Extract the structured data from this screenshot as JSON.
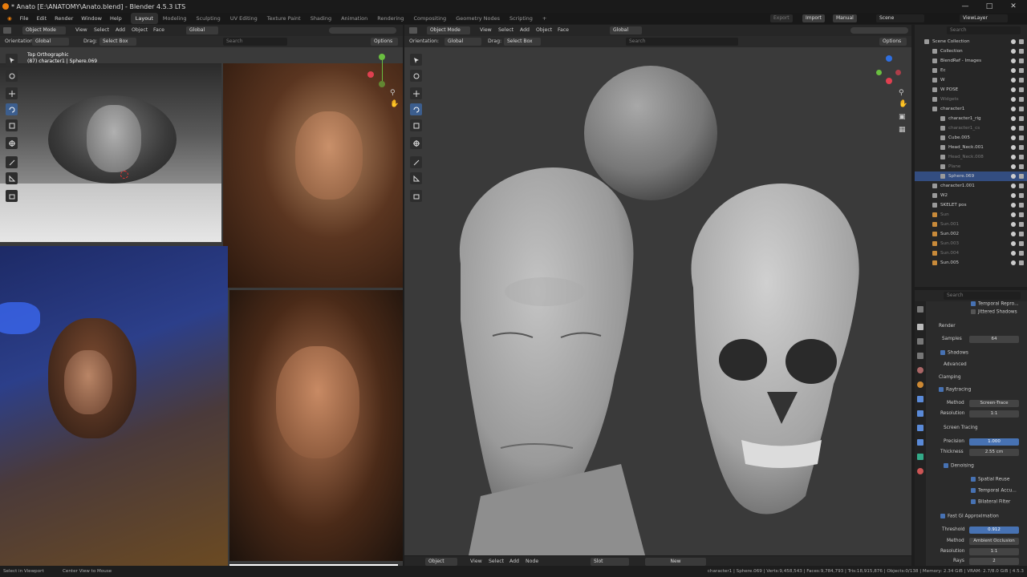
{
  "window": {
    "title": "* Anato [E:\\ANATOMY\\Anato.blend] - Blender 4.5.3 LTS"
  },
  "menubar": {
    "menus": [
      "File",
      "Edit",
      "Render",
      "Window",
      "Help"
    ],
    "workspaces": [
      "Layout",
      "Modeling",
      "Sculpting",
      "UV Editing",
      "Texture Paint",
      "Shading",
      "Animation",
      "Rendering",
      "Compositing",
      "Geometry Nodes",
      "Scripting"
    ],
    "add_tab": "+",
    "export": "Export",
    "import": "Import",
    "manual": "Manual",
    "scene": "Scene",
    "view_layer": "ViewLayer"
  },
  "left_editor": {
    "mode": "Object Mode",
    "menus": [
      "View",
      "Select",
      "Add",
      "Object",
      "Face"
    ],
    "orientation_label": "Orientation:",
    "orientation_value": "Global",
    "transform": "Global",
    "drag_label": "Drag:",
    "drag_value": "Select Box",
    "search_placeholder": "Search",
    "options": "Options",
    "overlay_line1": "Top Orthographic",
    "overlay_line2": "(87) character1 | Sphere.069"
  },
  "right_editor": {
    "mode": "Object Mode",
    "menus": [
      "View",
      "Select",
      "Add",
      "Object",
      "Face"
    ],
    "orientation_label": "Orientation:",
    "orientation_value": "Global",
    "transform": "Global",
    "drag_label": "Drag:",
    "drag_value": "Select Box",
    "search_placeholder": "Search",
    "options": "Options"
  },
  "outliner": {
    "search_placeholder": "Search",
    "items": [
      {
        "name": "Scene Collection",
        "dim": false,
        "sel": false
      },
      {
        "name": "Collection",
        "dim": false,
        "sel": false
      },
      {
        "name": "BlendRef - Images",
        "dim": false,
        "sel": false
      },
      {
        "name": "Ec",
        "dim": false,
        "sel": false
      },
      {
        "name": "W",
        "dim": false,
        "sel": false
      },
      {
        "name": "W POSE",
        "dim": false,
        "sel": false
      },
      {
        "name": "Widgets",
        "dim": true,
        "sel": false
      },
      {
        "name": "character1",
        "dim": false,
        "sel": false
      },
      {
        "name": "character1_rig",
        "dim": false,
        "sel": false
      },
      {
        "name": "character1_cs",
        "dim": true,
        "sel": false
      },
      {
        "name": "Cube.005",
        "dim": false,
        "sel": false
      },
      {
        "name": "Head_Neck.001",
        "dim": false,
        "sel": false
      },
      {
        "name": "Head_Neck.008",
        "dim": true,
        "sel": false
      },
      {
        "name": "Plane",
        "dim": true,
        "sel": false
      },
      {
        "name": "Sphere.069",
        "dim": false,
        "sel": true
      },
      {
        "name": "character1.001",
        "dim": false,
        "sel": false
      },
      {
        "name": "W2",
        "dim": false,
        "sel": false
      },
      {
        "name": "SKELET pos",
        "dim": false,
        "sel": false
      },
      {
        "name": "Sun",
        "dim": true,
        "sel": false
      },
      {
        "name": "Sun.001",
        "dim": true,
        "sel": false
      },
      {
        "name": "Sun.002",
        "dim": false,
        "sel": false
      },
      {
        "name": "Sun.003",
        "dim": true,
        "sel": false
      },
      {
        "name": "Sun.004",
        "dim": true,
        "sel": false
      },
      {
        "name": "Sun.005",
        "dim": false,
        "sel": false
      }
    ]
  },
  "properties": {
    "search_placeholder": "Search",
    "temporal_reprojection": "Temporal Repro...",
    "jittered_shadows": "Jittered Shadows",
    "render": "Render",
    "samples_label": "Samples",
    "samples_value": "64",
    "shadows": "Shadows",
    "advanced": "Advanced",
    "clamping": "Clamping",
    "raytracing": "Raytracing",
    "method_label": "Method",
    "method_value": "Screen-Trace",
    "resolution_label": "Resolution",
    "resolution_value": "1:1",
    "screen_tracing": "Screen Tracing",
    "precision_label": "Precision",
    "precision_value": "1.000",
    "thickness_label": "Thickness",
    "thickness_value": "2.55 cm",
    "denoising": "Denoising",
    "spatial_reuse": "Spatial Reuse",
    "temporal_accum": "Temporal Accu...",
    "bilateral_filter": "Bilateral Filter",
    "fast_gi": "Fast GI Approximation",
    "threshold_label": "Threshold",
    "threshold_value": "0.912",
    "gi_method_label": "Method",
    "gi_method_value": "Ambient Occlusion",
    "gi_resolution_label": "Resolution",
    "gi_resolution_value": "1:1",
    "rays_label": "Rays",
    "rays_value": "2"
  },
  "bottom_header": {
    "mode": "Object",
    "menus": [
      "View",
      "Select",
      "Add",
      "Node"
    ],
    "slot": "Slot",
    "new": "New"
  },
  "statusbar": {
    "left1": "Select in Viewport",
    "left2": "Center View to Mouse",
    "stats": "character1 | Sphere.069 | Verts:9,458,543 | Faces:9,784,793 | Tris:18,915,876 | Objects:0/138 | Memory: 2.34 GiB | VRAM: 2.7/8.0 GiB | 4.5.3"
  },
  "colors": {
    "accent": "#4772b3",
    "selection": "#334d80",
    "viewport_bg": "#3a3a3a"
  }
}
